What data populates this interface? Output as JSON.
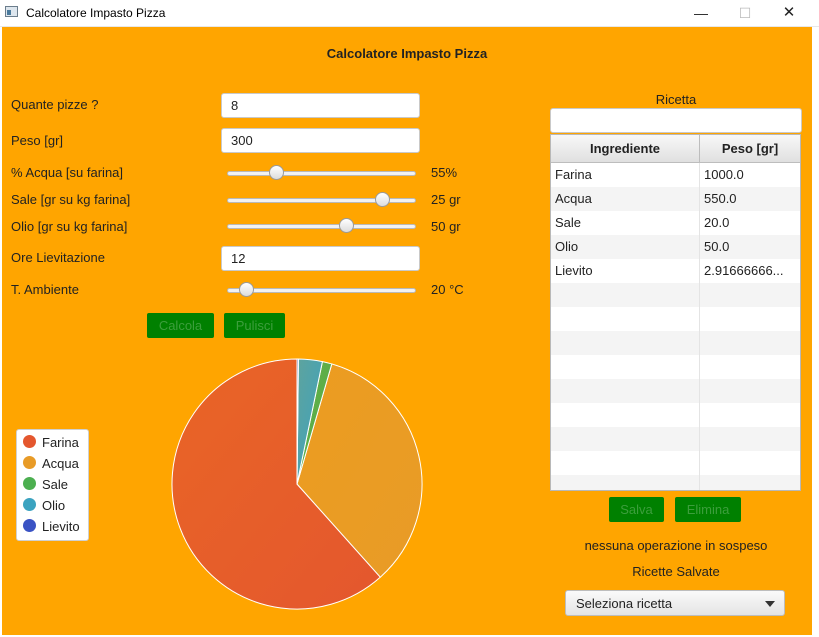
{
  "window": {
    "title": "Calcolatore Impasto Pizza",
    "controls": {
      "minimize": "—",
      "maximize": "☐",
      "close": "✕"
    }
  },
  "heading": "Calcolatore Impasto Pizza",
  "form": {
    "pizze": {
      "label": "Quante pizze ?",
      "value": "8"
    },
    "peso": {
      "label": "Peso [gr]",
      "value": "300"
    },
    "acqua": {
      "label": "% Acqua [su farina]",
      "value_text": "55%",
      "level": 0.26
    },
    "sale": {
      "label": "Sale [gr su kg farina]",
      "value_text": "25 gr",
      "level": 0.82
    },
    "olio": {
      "label": "Olio [gr su kg farina]",
      "value_text": "50 gr",
      "level": 0.63
    },
    "ore": {
      "label": "Ore Lievitazione",
      "value": "12"
    },
    "temp": {
      "label": "T. Ambiente",
      "value_text": "20 °C",
      "level": 0.1
    },
    "calcola_label": "Calcola",
    "pulisci_label": "Pulisci"
  },
  "chart_data": {
    "type": "pie",
    "title": "",
    "slices": [
      {
        "label": "Farina",
        "value": 1000.0,
        "color": "#e4572e"
      },
      {
        "label": "Acqua",
        "value": 550.0,
        "color": "#e89b27"
      },
      {
        "label": "Sale",
        "value": 20.0,
        "color": "#4caf50"
      },
      {
        "label": "Olio",
        "value": 50.0,
        "color": "#3ba3c0"
      },
      {
        "label": "Lievito",
        "value": 2.9166666,
        "color": "#3a53c4"
      }
    ],
    "legend_position": "left"
  },
  "ricetta": {
    "label": "Ricetta",
    "name_value": "",
    "columns": [
      "Ingrediente",
      "Peso [gr]"
    ],
    "rows": [
      [
        "Farina",
        "1000.0"
      ],
      [
        "Acqua",
        "550.0"
      ],
      [
        "Sale",
        "20.0"
      ],
      [
        "Olio",
        "50.0"
      ],
      [
        "Lievito",
        "2.91666666..."
      ]
    ],
    "salva_label": "Salva",
    "elimina_label": "Elimina",
    "status": "nessuna operazione in sospeso",
    "saved_label": "Ricette Salvate",
    "select_value": "Seleziona ricetta"
  }
}
